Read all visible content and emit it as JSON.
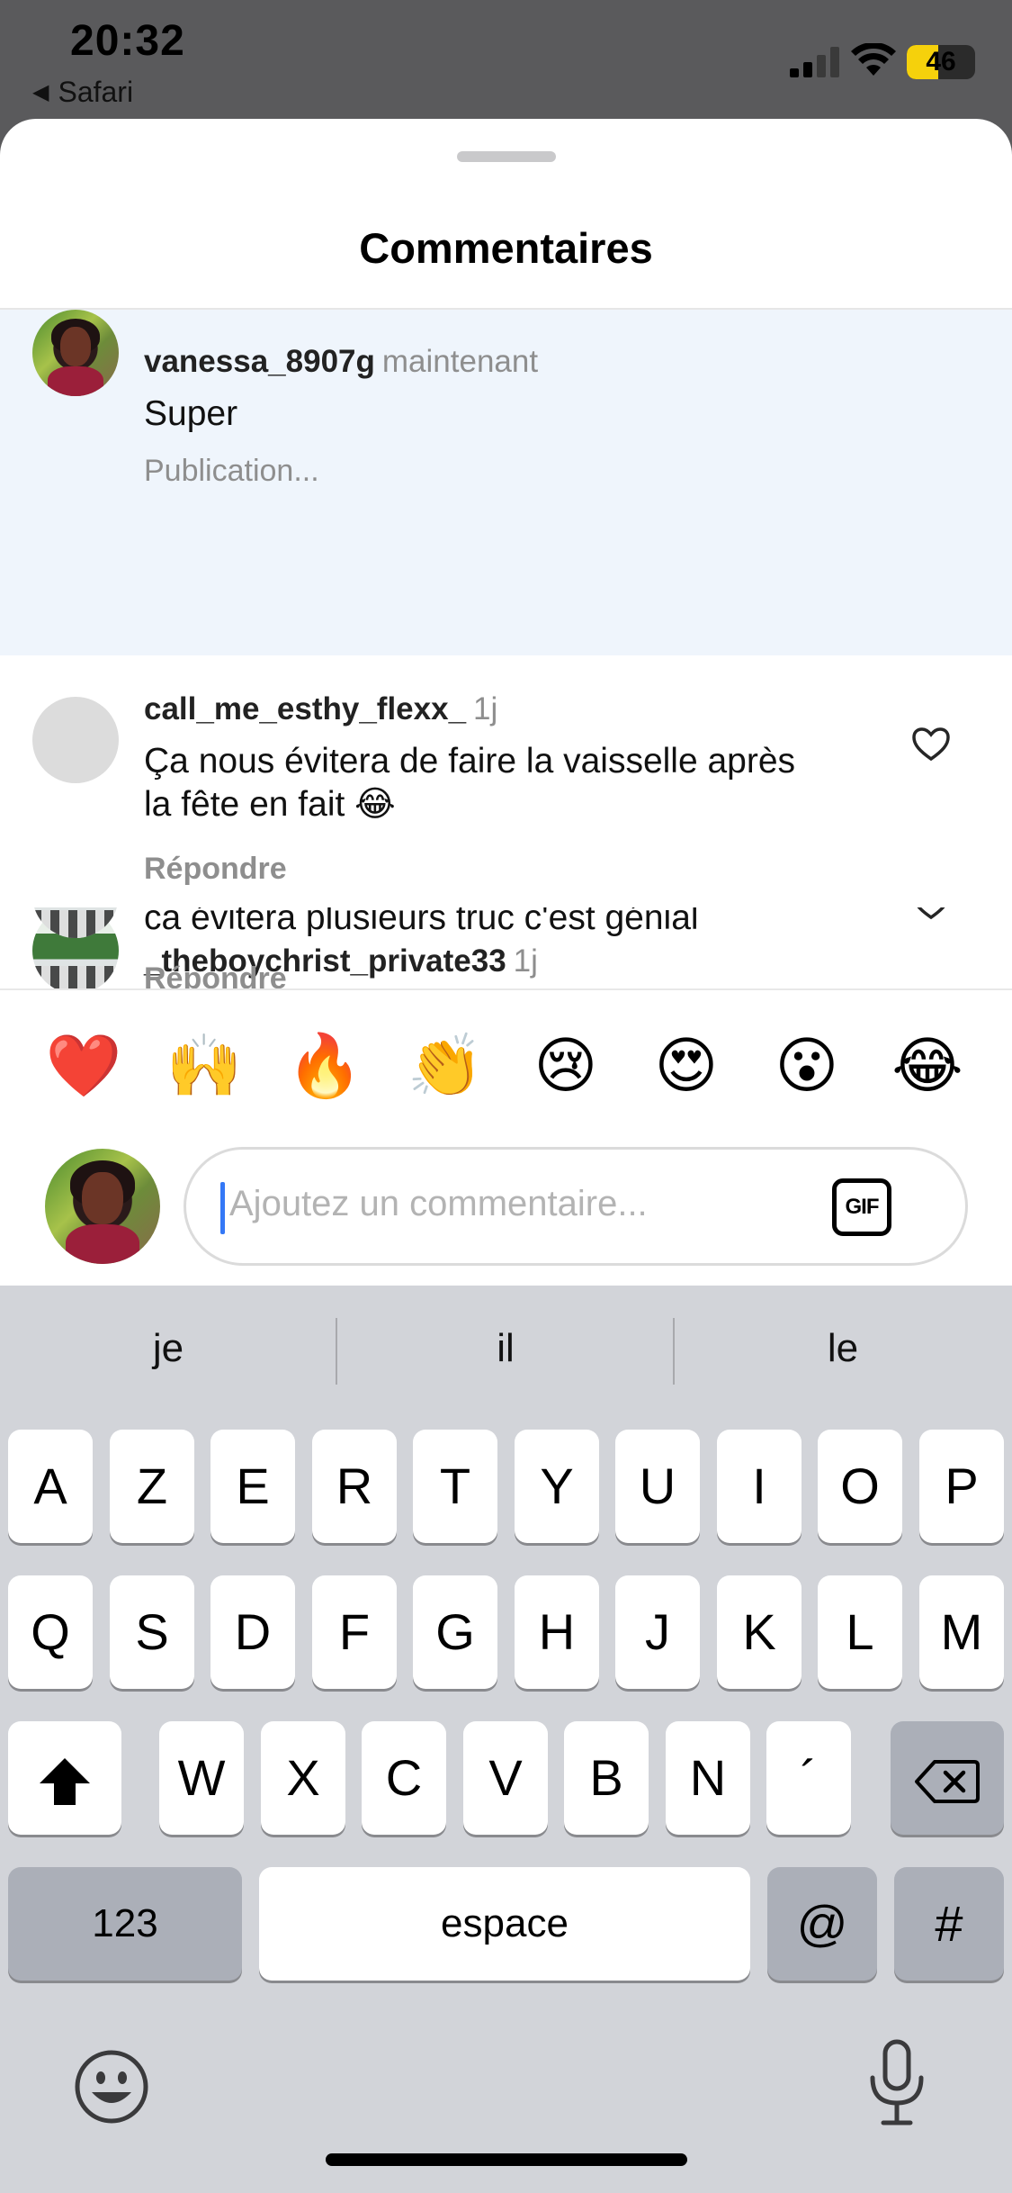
{
  "status_bar": {
    "time": "20:32",
    "back_app": "Safari",
    "battery": "46",
    "battery_level": 0.46,
    "battery_color": "#f5d10c"
  },
  "sheet": {
    "title": "Commentaires"
  },
  "comments": [
    {
      "username": "vanessa_8907g",
      "time": "maintenant",
      "text": "Super",
      "sub": "Publication...",
      "state": "posting",
      "highlight_color": "#eff5fc"
    },
    {
      "username": "call_me_esthy_flexx_",
      "time": "1j",
      "text_line1": "Ça nous évitera de faire la vaisselle après",
      "text_line2": "la fête en fait 😂",
      "sub": "Répondre"
    },
    {
      "username": "_theboychrist_private33",
      "time": "1j",
      "text": "ca évitera plusieurs truc c'est génial",
      "sub": "Répondre"
    }
  ],
  "quick_reactions": [
    "❤️",
    "🙌",
    "🔥",
    "👏",
    "😢",
    "😍",
    "😮",
    "😂"
  ],
  "composer": {
    "placeholder": "Ajoutez un commentaire...",
    "gif_label": "GIF",
    "caret_color": "#3478f6"
  },
  "keyboard": {
    "suggestions": [
      "je",
      "il",
      "le"
    ],
    "row1": [
      "A",
      "Z",
      "E",
      "R",
      "T",
      "Y",
      "U",
      "I",
      "O",
      "P"
    ],
    "row2": [
      "Q",
      "S",
      "D",
      "F",
      "G",
      "H",
      "J",
      "K",
      "L",
      "M"
    ],
    "row3": [
      "W",
      "X",
      "C",
      "V",
      "B",
      "N",
      "´"
    ],
    "numbers_key": "123",
    "space_key": "espace",
    "at_key": "@",
    "hash_key": "#"
  }
}
